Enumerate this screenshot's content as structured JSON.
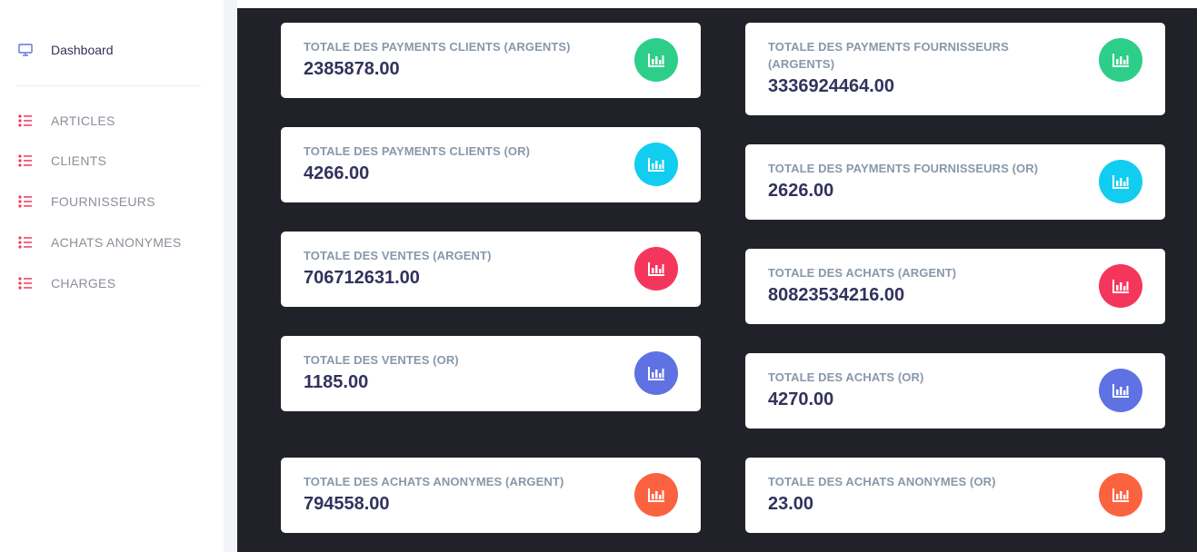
{
  "sidebar": {
    "items": [
      {
        "label": "Dashboard",
        "icon": "monitor-icon"
      },
      {
        "label": "ARTICLES",
        "icon": "list-icon"
      },
      {
        "label": "CLIENTS",
        "icon": "list-icon"
      },
      {
        "label": "FOURNISSEURS",
        "icon": "list-icon"
      },
      {
        "label": "ACHATS ANONYMES",
        "icon": "list-icon"
      },
      {
        "label": "CHARGES",
        "icon": "list-icon"
      }
    ]
  },
  "colors": {
    "green": "#2dce89",
    "cyan": "#11cdef",
    "red": "#f5365c",
    "indigo": "#5e72e4",
    "orange": "#fb6340",
    "nav_icon_red": "#f5365c",
    "nav_icon_blue": "#5e72e4"
  },
  "cards": [
    {
      "title": "TOTALE DES PAYMENTS CLIENTS (ARGENTS)",
      "value": "2385878.00",
      "icon": "chart-bar-icon",
      "color": "green"
    },
    {
      "title": "TOTALE DES PAYMENTS FOURNISSEURS (ARGENTS)",
      "value": "3336924464.00",
      "icon": "chart-bar-icon",
      "color": "green"
    },
    {
      "title": "TOTALE DES PAYMENTS CLIENTS (OR)",
      "value": "4266.00",
      "icon": "chart-bar-icon",
      "color": "cyan"
    },
    {
      "title": "TOTALE DES PAYMENTS FOURNISSEURS (OR)",
      "value": "2626.00",
      "icon": "chart-bar-icon",
      "color": "cyan"
    },
    {
      "title": "TOTALE DES VENTES (ARGENT)",
      "value": "706712631.00",
      "icon": "chart-bar-icon",
      "color": "red"
    },
    {
      "title": "TOTALE DES ACHATS (ARGENT)",
      "value": "80823534216.00",
      "icon": "chart-bar-icon",
      "color": "red"
    },
    {
      "title": "TOTALE DES VENTES (OR)",
      "value": "1185.00",
      "icon": "chart-bar-icon",
      "color": "indigo"
    },
    {
      "title": "TOTALE DES ACHATS (OR)",
      "value": "4270.00",
      "icon": "chart-bar-icon",
      "color": "indigo"
    },
    {
      "title": "TOTALE DES ACHATS ANONYMES (ARGENT)",
      "value": "794558.00",
      "icon": "chart-bar-icon",
      "color": "orange"
    },
    {
      "title": "TOTALE DES ACHATS ANONYMES (OR)",
      "value": "23.00",
      "icon": "chart-bar-icon",
      "color": "orange"
    }
  ]
}
